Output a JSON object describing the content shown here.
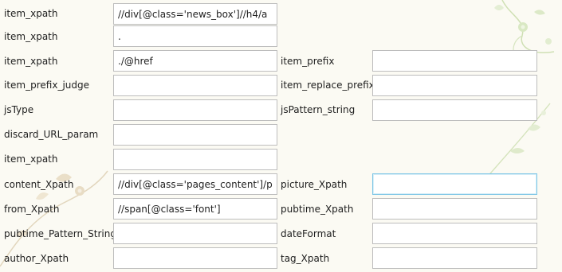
{
  "form": {
    "rows": [
      {
        "left_label": "item_xpath",
        "left_value": "//div[@class='news_box']//h4/a"
      },
      {
        "left_label": "item_xpath",
        "left_value": "."
      },
      {
        "left_label": "item_xpath",
        "left_value": "./@href",
        "right_label": "item_prefix",
        "right_value": ""
      },
      {
        "left_label": "item_prefix_judge",
        "left_value": "",
        "right_label": "item_replace_prefix",
        "right_value": ""
      },
      {
        "left_label": "jsType",
        "left_value": "",
        "right_label": "jsPattern_string",
        "right_value": ""
      },
      {
        "left_label": "discard_URL_param",
        "left_value": ""
      },
      {
        "left_label": "item_xpath",
        "left_value": ""
      },
      {
        "left_label": "content_Xpath",
        "left_value": "//div[@class='pages_content']/p",
        "right_label": "picture_Xpath",
        "right_value": ""
      },
      {
        "left_label": "from_Xpath",
        "left_value": "//span[@class='font']",
        "right_label": "pubtime_Xpath",
        "right_value": ""
      },
      {
        "left_label": "pubtime_Pattern_String",
        "left_value": "",
        "right_label": "dateFormat",
        "right_value": ""
      },
      {
        "left_label": "author_Xpath",
        "left_value": "",
        "right_label": "tag_Xpath",
        "right_value": ""
      }
    ]
  },
  "background": {
    "color": "#fbfaf3",
    "decoration": "floral-vine-watermark"
  },
  "accent": {
    "focus_border": "#7ec6e6",
    "input_border": "#bdbdbd"
  }
}
